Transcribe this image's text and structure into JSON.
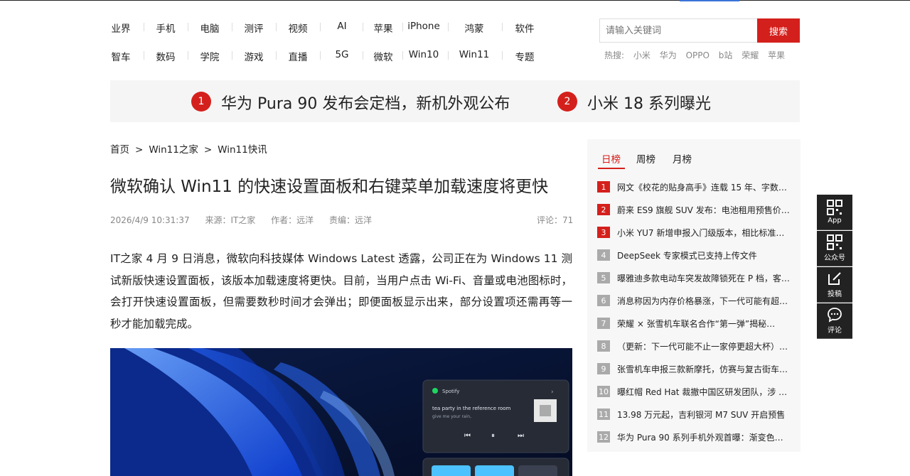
{
  "nav": {
    "row1": [
      "业界",
      "手机",
      "电脑",
      "测评",
      "视频",
      "AI",
      "苹果",
      "iPhone",
      "鸿蒙",
      "软件"
    ],
    "row2": [
      "智车",
      "数码",
      "学院",
      "游戏",
      "直播",
      "5G",
      "微软",
      "Win10",
      "Win11",
      "专题"
    ]
  },
  "search": {
    "placeholder": "请输入关键词",
    "button": "搜索",
    "hot_label": "热搜:",
    "hot_terms": [
      "小米",
      "华为",
      "OPPO",
      "b站",
      "荣耀",
      "苹果"
    ]
  },
  "banner": {
    "items": [
      {
        "num": "1",
        "text": "华为 Pura 90 发布会定档，新机外观公布"
      },
      {
        "num": "2",
        "text": "小米 18 系列曝光"
      }
    ]
  },
  "breadcrumb": {
    "home": "首页",
    "sep": ">",
    "section": "Win11之家",
    "sub": "Win11快讯"
  },
  "article": {
    "title": "微软确认 Win11 的快速设置面板和右键菜单加载速度将更快",
    "date": "2026/4/9 10:31:37",
    "source": "来源：IT之家",
    "author": "作者：远洋",
    "editor": "责编：远洋",
    "comments": "评论：71",
    "body": "IT之家 4 月 9 日消息，微软向科技媒体 Windows Latest 透露，公司正在为 Windows 11 测试新版快速设置面板，该版本加载速度将更快。目前，当用户点击 Wi-Fi、音量或电池图标时，会打开快速设置面板，但需要数秒时间才会弹出；即便面板显示出来，部分设置项还需再等一秒才能加载完成。"
  },
  "media_card": {
    "app": "Spotify",
    "track": "tea party in the reference room",
    "artist": "give me your rain,"
  },
  "sidebar": {
    "tabs": [
      "日榜",
      "周榜",
      "月榜"
    ],
    "items": [
      {
        "num": "1",
        "text": "网文《校花的贴身高手》连载 15 年、字数…"
      },
      {
        "num": "2",
        "text": "蔚来 ES9 旗舰 SUV 发布：电池租用预售价…"
      },
      {
        "num": "3",
        "text": "小米 YU7 新增申报入门级版本，相比标准…"
      },
      {
        "num": "4",
        "text": "DeepSeek 专家模式已支持上传文件"
      },
      {
        "num": "5",
        "text": "曝雅迪多款电动车突发故障锁死在 P 档，客…"
      },
      {
        "num": "6",
        "text": "消息称因为内存价格暴涨，下一代可能有超…"
      },
      {
        "num": "7",
        "text": "荣耀 × 张雪机车联名合作“第一弹”揭秘…"
      },
      {
        "num": "8",
        "text": "（更新：下一代可能不止一家停更超大杯）…"
      },
      {
        "num": "9",
        "text": "张雪机车申报三款新摩托，仿赛与复古街车…"
      },
      {
        "num": "10",
        "text": "曝红帽 Red Hat 裁撤中国区研发团队，涉 …"
      },
      {
        "num": "11",
        "text": "13.98 万元起，吉利银河 M7 SUV 开启预售"
      },
      {
        "num": "12",
        "text": "华为 Pura 90 系列手机外观首曝：渐变色…"
      }
    ]
  },
  "float_bar": [
    "App",
    "公众号",
    "投稿",
    "评论"
  ],
  "colors": {
    "accent": "#d4201c",
    "rank_gray": "#aaaaaa",
    "float_bg": "#222222"
  }
}
